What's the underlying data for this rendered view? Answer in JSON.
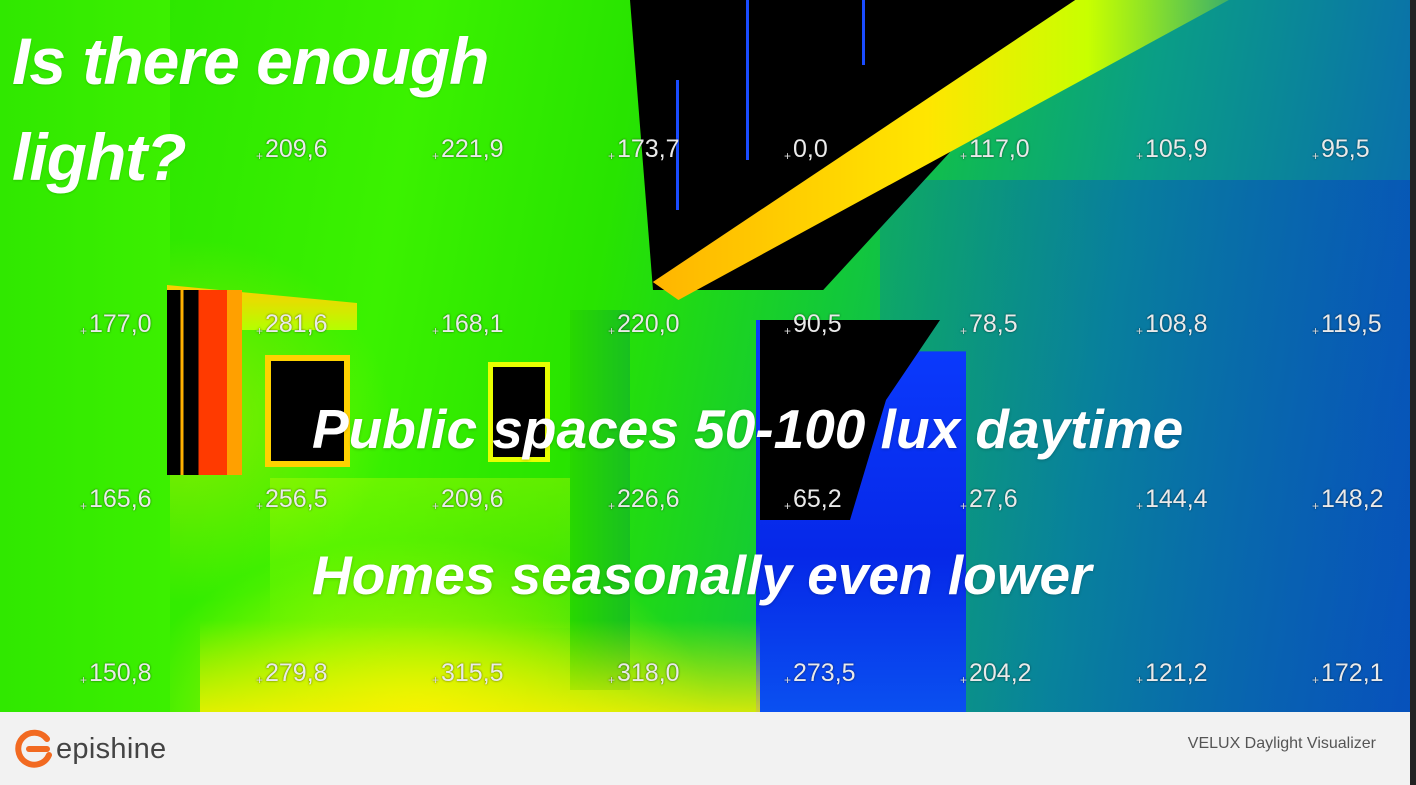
{
  "slide": {
    "title": "Is there enough light?",
    "line1": "Public spaces 50-100 lux daytime",
    "line2": "Homes seasonally even lower"
  },
  "lux_grid": {
    "rows": [
      [
        "209,6",
        "221,9",
        "173,7",
        "0,0",
        "117,0",
        "105,9",
        "95,5"
      ],
      [
        "177,0",
        "281,6",
        "168,1",
        "220,0",
        "90,5",
        "78,5",
        "108,8",
        "119,5"
      ],
      [
        "165,6",
        "256,5",
        "209,6",
        "226,6",
        "65,2",
        "27,6",
        "144,4",
        "148,2"
      ],
      [
        "150,8",
        "279,8",
        "315,5",
        "318,0",
        "273,5",
        "204,2",
        "121,2",
        "172,1"
      ]
    ]
  },
  "footer": {
    "logo_text": "epishine",
    "credit": "VELUX Daylight Visualizer"
  },
  "colors": {
    "logo_orange": "#f26a21",
    "text_white": "#ffffff"
  }
}
